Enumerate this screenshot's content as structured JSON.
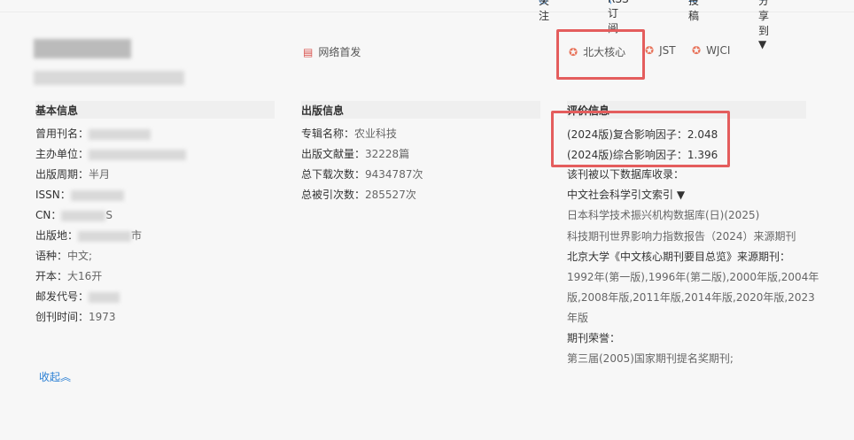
{
  "topbar": {
    "follow": "关注",
    "rss": "RSS订阅",
    "submit": "投稿",
    "share": "分享到 ▼"
  },
  "header": {
    "online_first": "网络首发",
    "badges": [
      "北大核心",
      "JST",
      "WJCI"
    ]
  },
  "basic": {
    "title": "基本信息",
    "rows": [
      {
        "label": "曾用刊名：",
        "value": ""
      },
      {
        "label": "主办单位：",
        "value": ""
      },
      {
        "label": "出版周期：",
        "value": "半月"
      },
      {
        "label": "ISSN：",
        "value": ""
      },
      {
        "label": "CN：",
        "value": "S"
      },
      {
        "label": "出版地：",
        "value": "市"
      },
      {
        "label": "语种：",
        "value": "中文;"
      },
      {
        "label": "开本：",
        "value": "大16开"
      },
      {
        "label": "邮发代号：",
        "value": ""
      },
      {
        "label": "创刊时间：",
        "value": "1973"
      }
    ]
  },
  "publish": {
    "title": "出版信息",
    "rows": [
      {
        "label": "专辑名称：",
        "value": "农业科技"
      },
      {
        "label": "出版文献量：",
        "value": "32228篇"
      },
      {
        "label": "总下载次数：",
        "value": "9434787次"
      },
      {
        "label": "总被引次数：",
        "value": "285527次"
      }
    ]
  },
  "eval": {
    "title": "评价信息",
    "if_composite": "(2024版)复合影响因子：2.048",
    "if_comprehensive": "(2024版)综合影响因子：1.396",
    "db_label": "该刊被以下数据库收录：",
    "db_select": "中文社会科学引文索引 ▼",
    "db_items": [
      "日本科学技术振兴机构数据库(日)(2025)",
      "科技期刊世界影响力指数报告（2024）来源期刊"
    ],
    "pku_label": "北京大学《中文核心期刊要目总览》来源期刊：",
    "pku_lines": [
      "1992年(第一版),1996年(第二版),2000年版,2004年",
      "版,2008年版,2011年版,2014年版,2020年版,2023",
      "年版"
    ],
    "honor_label": "期刊荣誉：",
    "honor": "第三届(2005)国家期刊提名奖期刊;"
  },
  "collapse": "收起︽"
}
